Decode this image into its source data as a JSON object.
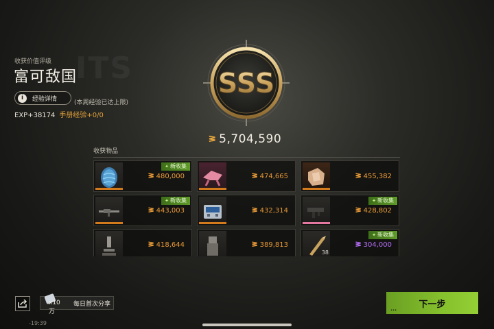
{
  "header": {
    "rating_caption": "收获价值评级",
    "rating_title": "富可敌国",
    "exp_details_button": "经验详情",
    "weekly_cap_note": "(本周经验已达上限)",
    "exp_gain": "EXP+38174",
    "handbook_exp": "手册经验+0/0"
  },
  "medal": {
    "grade": "SSS"
  },
  "total_value": "5,704,590",
  "section": {
    "label": "收获物品"
  },
  "items": [
    {
      "name": "egg-item",
      "price": "480,000",
      "price_color": "orange",
      "new": true,
      "rarity": "orange",
      "qty": ""
    },
    {
      "name": "pink-frame-item",
      "price": "474,665",
      "price_color": "orange",
      "new": false,
      "rarity": "orange",
      "qty": ""
    },
    {
      "name": "crystal-block-item",
      "price": "455,382",
      "price_color": "orange",
      "new": false,
      "rarity": "orange",
      "qty": ""
    },
    {
      "name": "rifle-item",
      "price": "443,003",
      "price_color": "orange",
      "new": true,
      "rarity": "orange",
      "qty": ""
    },
    {
      "name": "device-case-item",
      "price": "432,314",
      "price_color": "orange",
      "new": false,
      "rarity": "orange",
      "qty": ""
    },
    {
      "name": "smg-item",
      "price": "428,802",
      "price_color": "orange",
      "new": true,
      "rarity": "pink",
      "qty": ""
    },
    {
      "name": "microscope-item",
      "price": "418,644",
      "price_color": "orange",
      "new": false,
      "rarity": "orange",
      "qty": ""
    },
    {
      "name": "statue-item",
      "price": "389,813",
      "price_color": "orange",
      "new": false,
      "rarity": "orange",
      "qty": ""
    },
    {
      "name": "ammo-item",
      "price": "304,000",
      "price_color": "purple",
      "new": true,
      "rarity": "purple",
      "qty": "38"
    }
  ],
  "new_badge_label": "新收集",
  "footer": {
    "share_reward": "x10万",
    "share_label": "每日首次分享",
    "next_button": "下一步",
    "next_dots": "...",
    "clock": "-19:39"
  }
}
